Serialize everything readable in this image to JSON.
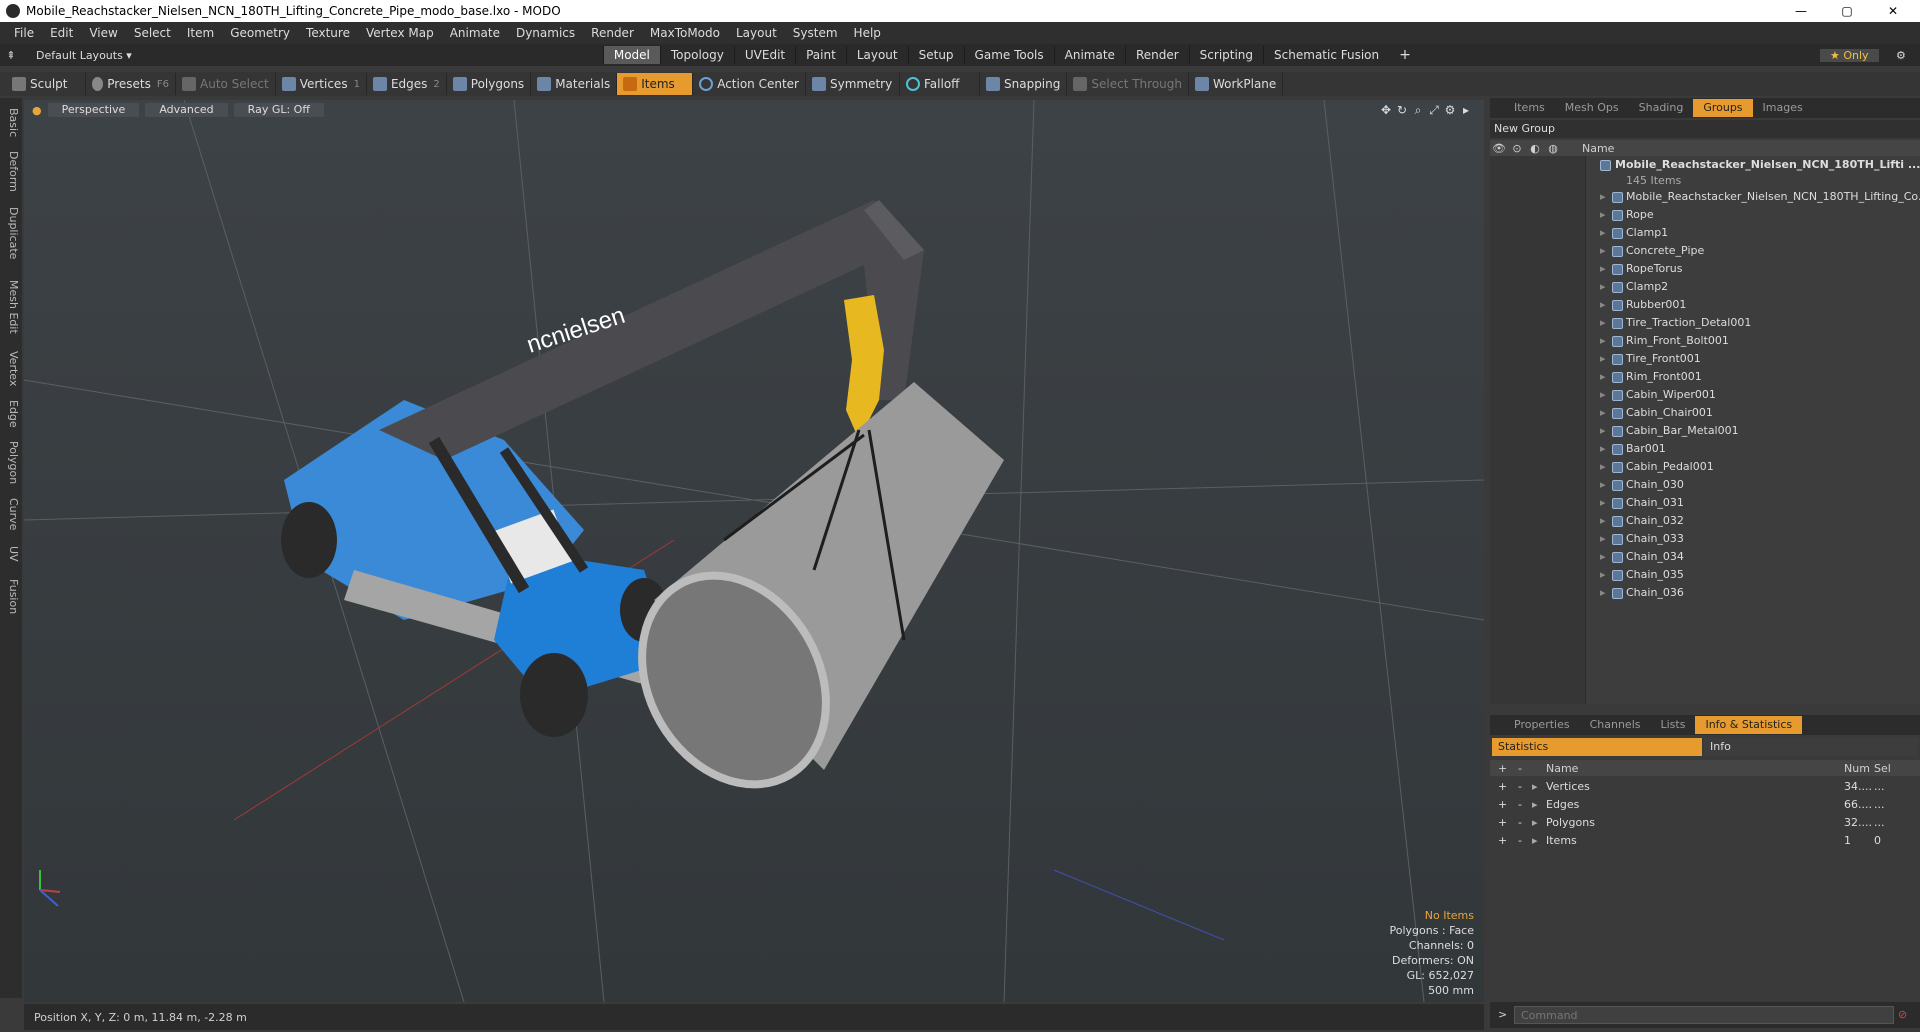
{
  "window": {
    "title": "Mobile_Reachstacker_Nielsen_NCN_180TH_Lifting_Concrete_Pipe_modo_base.lxo - MODO",
    "minimize": "—",
    "maximize": "▢",
    "close": "✕"
  },
  "menu": [
    "File",
    "Edit",
    "View",
    "Select",
    "Item",
    "Geometry",
    "Texture",
    "Vertex Map",
    "Animate",
    "Dynamics",
    "Render",
    "MaxToModo",
    "Layout",
    "System",
    "Help"
  ],
  "layoutbar": {
    "layout_menu": "Default Layouts ▾",
    "tabs": [
      "Model",
      "Topology",
      "UVEdit",
      "Paint",
      "Layout",
      "Setup",
      "Game Tools",
      "Animate",
      "Render",
      "Scripting",
      "Schematic Fusion"
    ],
    "active_tab": "Model",
    "add": "+",
    "only": "★  Only",
    "gear": "⚙"
  },
  "toolbar": {
    "sculpt": "Sculpt",
    "presets": "Presets",
    "presets_key": "F6",
    "auto_select": "Auto Select",
    "vertices": "Vertices",
    "vertices_num": "1",
    "edges": "Edges",
    "edges_num": "2",
    "polygons": "Polygons",
    "materials": "Materials",
    "items": "Items",
    "action_center": "Action Center",
    "symmetry": "Symmetry",
    "falloff": "Falloff",
    "snapping": "Snapping",
    "select_through": "Select Through",
    "workplane": "WorkPlane"
  },
  "left_tabs": [
    "Basic",
    "Deform",
    "Duplicate",
    "Mesh Edit",
    "Vertex",
    "Edge",
    "Polygon",
    "Curve",
    "UV",
    "Fusion"
  ],
  "viewport": {
    "perspective": "Perspective",
    "advanced": "Advanced",
    "raygl": "Ray GL: Off",
    "info": {
      "no_items": "No Items",
      "polygons": "Polygons : Face",
      "channels": "Channels: 0",
      "deformers": "Deformers: ON",
      "gl": "GL: 652,027",
      "size": "500 mm"
    },
    "brand_text": "ncnielsen"
  },
  "status": {
    "position": "Position X, Y, Z:  0 m, 11.84 m, -2.28 m"
  },
  "panel_tabs": [
    "Items",
    "Mesh Ops",
    "Shading",
    "Groups",
    "Images"
  ],
  "panel_active": "Groups",
  "groups": {
    "new_group": "New Group",
    "name_col": "Name",
    "root": "Mobile_Reachstacker_Nielsen_NCN_180TH_Lifti ...",
    "root_count": "145 Items",
    "items": [
      "Mobile_Reachstacker_Nielsen_NCN_180TH_Lifting_Co...",
      "Rope",
      "Clamp1",
      "Concrete_Pipe",
      "RopeTorus",
      "Clamp2",
      "Rubber001",
      "Tire_Traction_Detal001",
      "Rim_Front_Bolt001",
      "Tire_Front001",
      "Rim_Front001",
      "Cabin_Wiper001",
      "Cabin_Chair001",
      "Cabin_Bar_Metal001",
      "Bar001",
      "Cabin_Pedal001",
      "Chain_030",
      "Chain_031",
      "Chain_032",
      "Chain_033",
      "Chain_034",
      "Chain_035",
      "Chain_036"
    ]
  },
  "lower_tabs": [
    "Properties",
    "Channels",
    "Lists",
    "Info & Statistics"
  ],
  "lower_active": "Info & Statistics",
  "stats": {
    "tab_statistics": "Statistics",
    "tab_info": "Info",
    "col_name": "Name",
    "col_num": "Num",
    "col_sel": "Sel",
    "rows": [
      {
        "name": "Vertices",
        "num": "34....",
        "sel": "..."
      },
      {
        "name": "Edges",
        "num": "66....",
        "sel": "..."
      },
      {
        "name": "Polygons",
        "num": "32....",
        "sel": "..."
      },
      {
        "name": "Items",
        "num": "1",
        "sel": "0"
      }
    ]
  },
  "command": {
    "placeholder": "Command"
  }
}
